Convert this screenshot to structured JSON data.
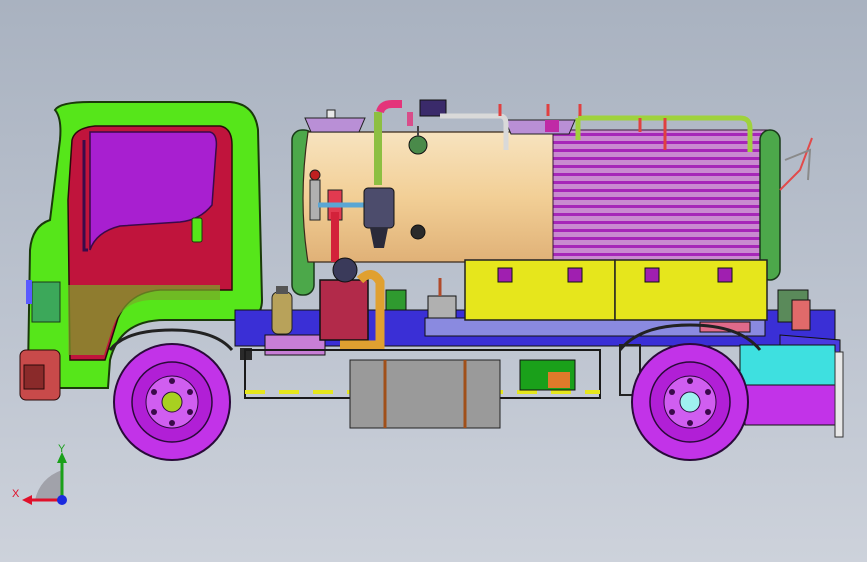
{
  "viewport": {
    "background_top": "#a9b2c0",
    "background_bottom": "#cdd2db"
  },
  "triad": {
    "x_label": "X",
    "y_label": "Y",
    "x_color": "#e0102a",
    "y_color": "#1aa01a",
    "z_color": "#1a2adf"
  },
  "model": {
    "cab_color": "#56e61a",
    "door_color": "#c0143c",
    "window_color": "#a81fd0",
    "tank_body_color": "#f2d29a",
    "tank_stripe_color": "#b92fc6",
    "toolbox_color": "#e6e61c",
    "frame_color": "#3a2fd6",
    "wheel_color": "#c233e8"
  }
}
